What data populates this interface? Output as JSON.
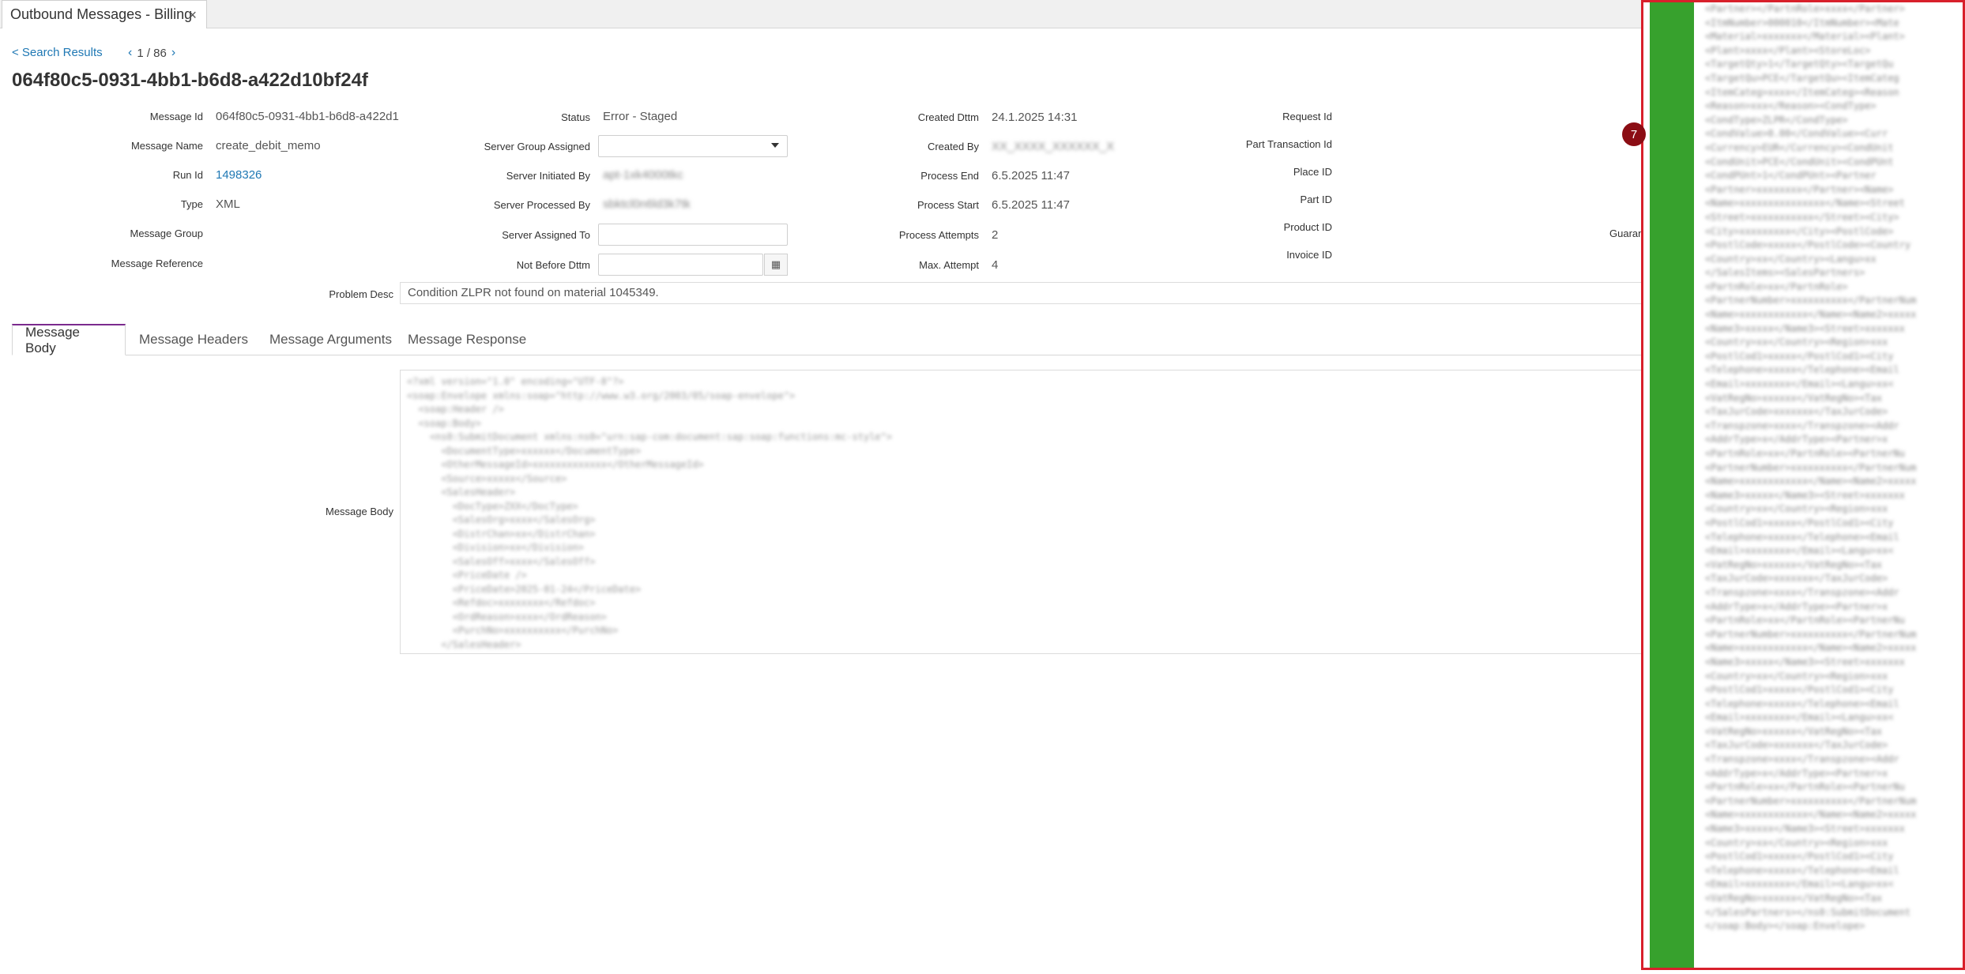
{
  "tab": {
    "title": "Outbound Messages - Billing",
    "close": "×"
  },
  "nav": {
    "back": "< Search Results",
    "pager": "1 / 86",
    "prev": "‹",
    "next": "›"
  },
  "page_title": "064f80c5-0931-4bb1-b6d8-a422d10bf24f",
  "col1": {
    "message_id_label": "Message Id",
    "message_id": "064f80c5-0931-4bb1-b6d8-a422d1",
    "message_name_label": "Message Name",
    "message_name": "create_debit_memo",
    "run_id_label": "Run Id",
    "run_id": "1498326",
    "type_label": "Type",
    "type": "XML",
    "message_group_label": "Message Group",
    "message_reference_label": "Message Reference"
  },
  "col2": {
    "status_label": "Status",
    "status": "Error - Staged",
    "server_group_label": "Server Group Assigned",
    "server_initiated_label": "Server Initiated By",
    "server_initiated": "apt-1xk4000tkc",
    "server_processed_label": "Server Processed By",
    "server_processed": "sbktcl0n6ld3k7tk",
    "server_assigned_label": "Server Assigned To",
    "not_before_label": "Not Before Dttm"
  },
  "col3": {
    "created_dttm_label": "Created Dttm",
    "created_dttm": "24.1.2025 14:31",
    "created_by_label": "Created By",
    "created_by": "XX_XXXX_XXXXXX_X",
    "process_end_label": "Process End",
    "process_end": "6.5.2025 11:47",
    "process_start_label": "Process Start",
    "process_start": "6.5.2025 11:47",
    "process_attempts_label": "Process Attempts",
    "process_attempts": "2",
    "max_attempt_label": "Max. Attempt",
    "max_attempt": "4"
  },
  "col4": {
    "request_id_label": "Request Id",
    "part_transaction_label": "Part Transaction Id",
    "place_id_label": "Place ID",
    "part_id_label": "Part ID",
    "product_id_label": "Product ID",
    "invoice_id_label": "Invoice ID",
    "guarantee_partial": "Guarante"
  },
  "problem": {
    "label": "Problem Desc",
    "text": "Condition ZLPR not found on material 1045349."
  },
  "content_tabs": [
    "Message Body",
    "Message Headers",
    "Message Arguments",
    "Message Response"
  ],
  "message_body_label": "Message Body",
  "badge": "7",
  "colors": {
    "accent_link": "#1f78b4",
    "tab_active": "#7b2a8e",
    "panel_border": "#d8202b",
    "panel_bar": "#37a12d",
    "badge": "#8b0d14"
  }
}
